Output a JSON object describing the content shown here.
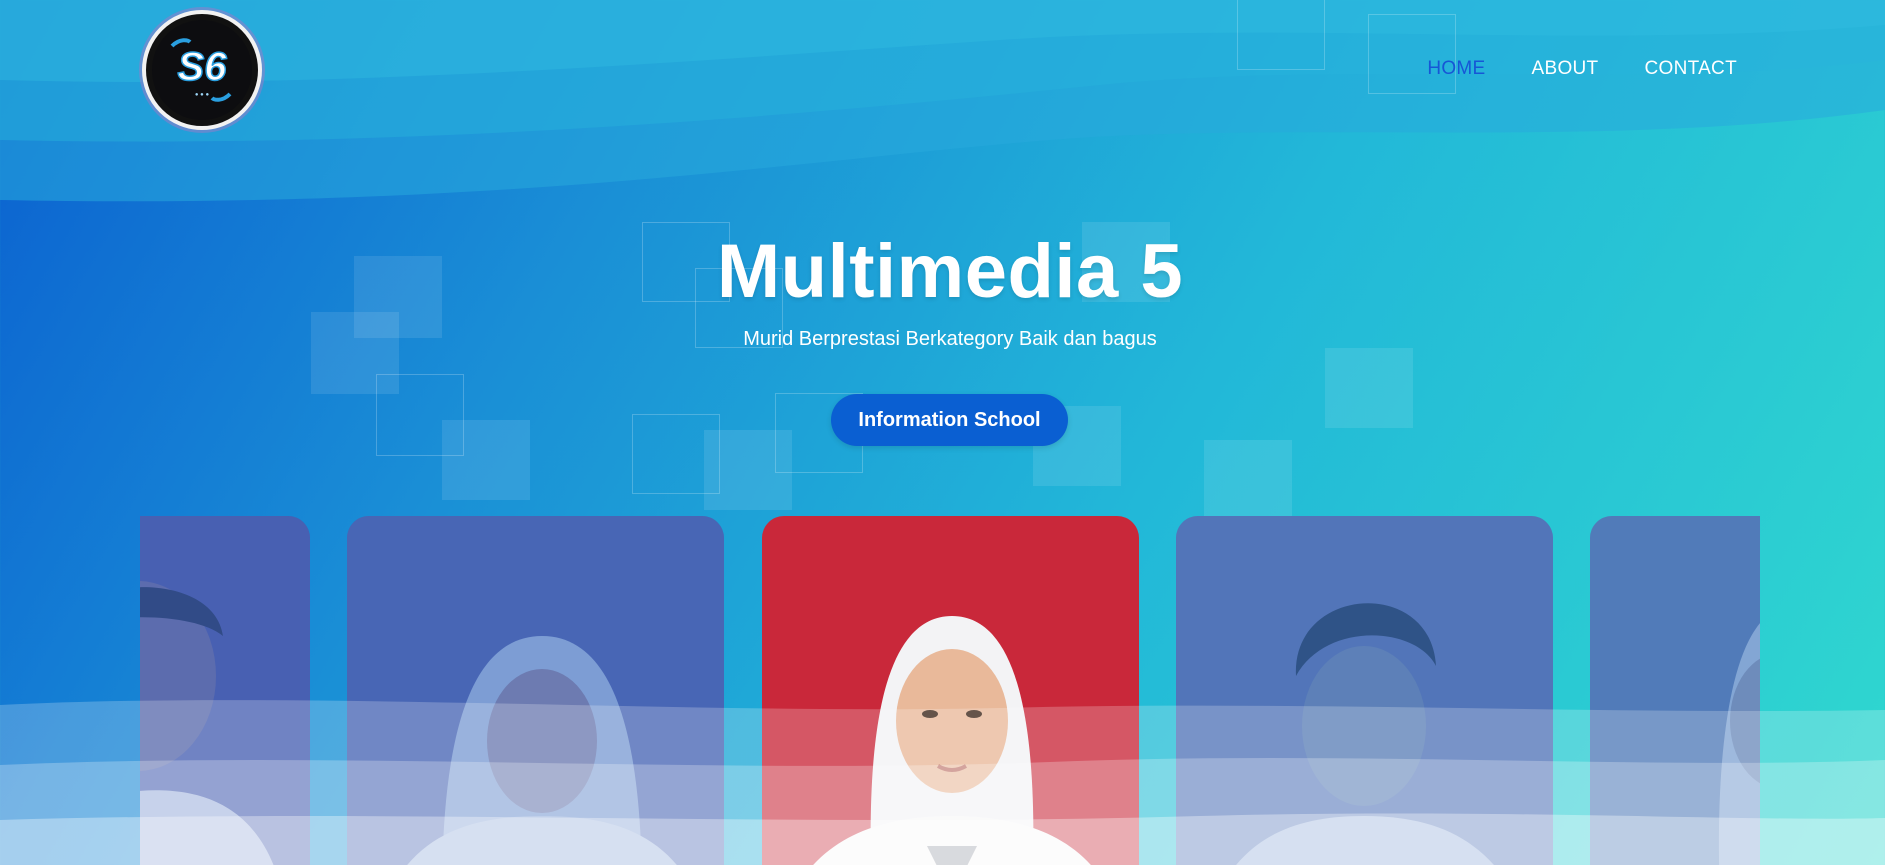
{
  "header": {
    "logo_alt": "S6",
    "nav": [
      {
        "label": "HOME",
        "active": true
      },
      {
        "label": "ABOUT",
        "active": false
      },
      {
        "label": "CONTACT",
        "active": false
      }
    ]
  },
  "hero": {
    "title": "Multimedia 5",
    "subtitle": "Murid Berprestasi Berkategory Baik dan bagus",
    "button_label": "Information School"
  },
  "cards": [
    {
      "name": "student-card-1",
      "bg": "#5b6cc4",
      "gender": "male",
      "active": false
    },
    {
      "name": "student-card-2",
      "bg": "#4e63b8",
      "gender": "female",
      "active": false
    },
    {
      "name": "student-card-3",
      "bg": "#c8263a",
      "gender": "female",
      "active": true
    },
    {
      "name": "student-card-4",
      "bg": "#5a7fbd",
      "gender": "male",
      "active": false
    },
    {
      "name": "student-card-5",
      "bg": "#5d86b8",
      "gender": "female",
      "active": false
    }
  ],
  "colors": {
    "accent": "#0a5fd2",
    "nav_active": "#1656d6",
    "gradient_start": "#0a5fd0",
    "gradient_end": "#30d8cf"
  }
}
